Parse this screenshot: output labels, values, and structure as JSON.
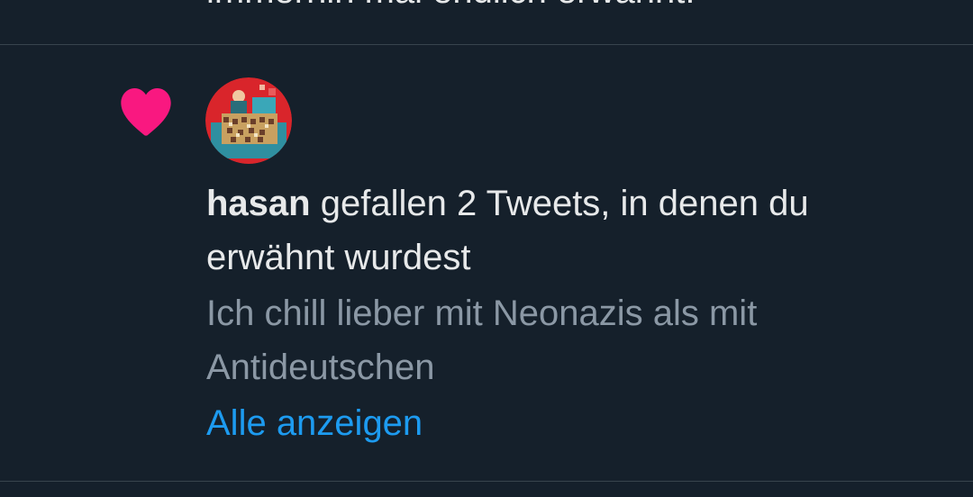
{
  "previous_item": {
    "text": "immerhin mal endlich erwähnt."
  },
  "notification": {
    "icon": "heart-icon",
    "icon_color": "#f91880",
    "user_name": "hasan",
    "action_text": " gefallen 2 Tweets, in denen du erwähnt wurdest",
    "tweet_preview": "Ich chill lieber mit Neonazis als mit Antideutschen",
    "show_all_label": "Alle anzeigen"
  },
  "colors": {
    "background": "#15202b",
    "primary_text": "#e7e9ea",
    "secondary_text": "#8b98a5",
    "link": "#1d9bf0",
    "divider": "#38444d"
  }
}
